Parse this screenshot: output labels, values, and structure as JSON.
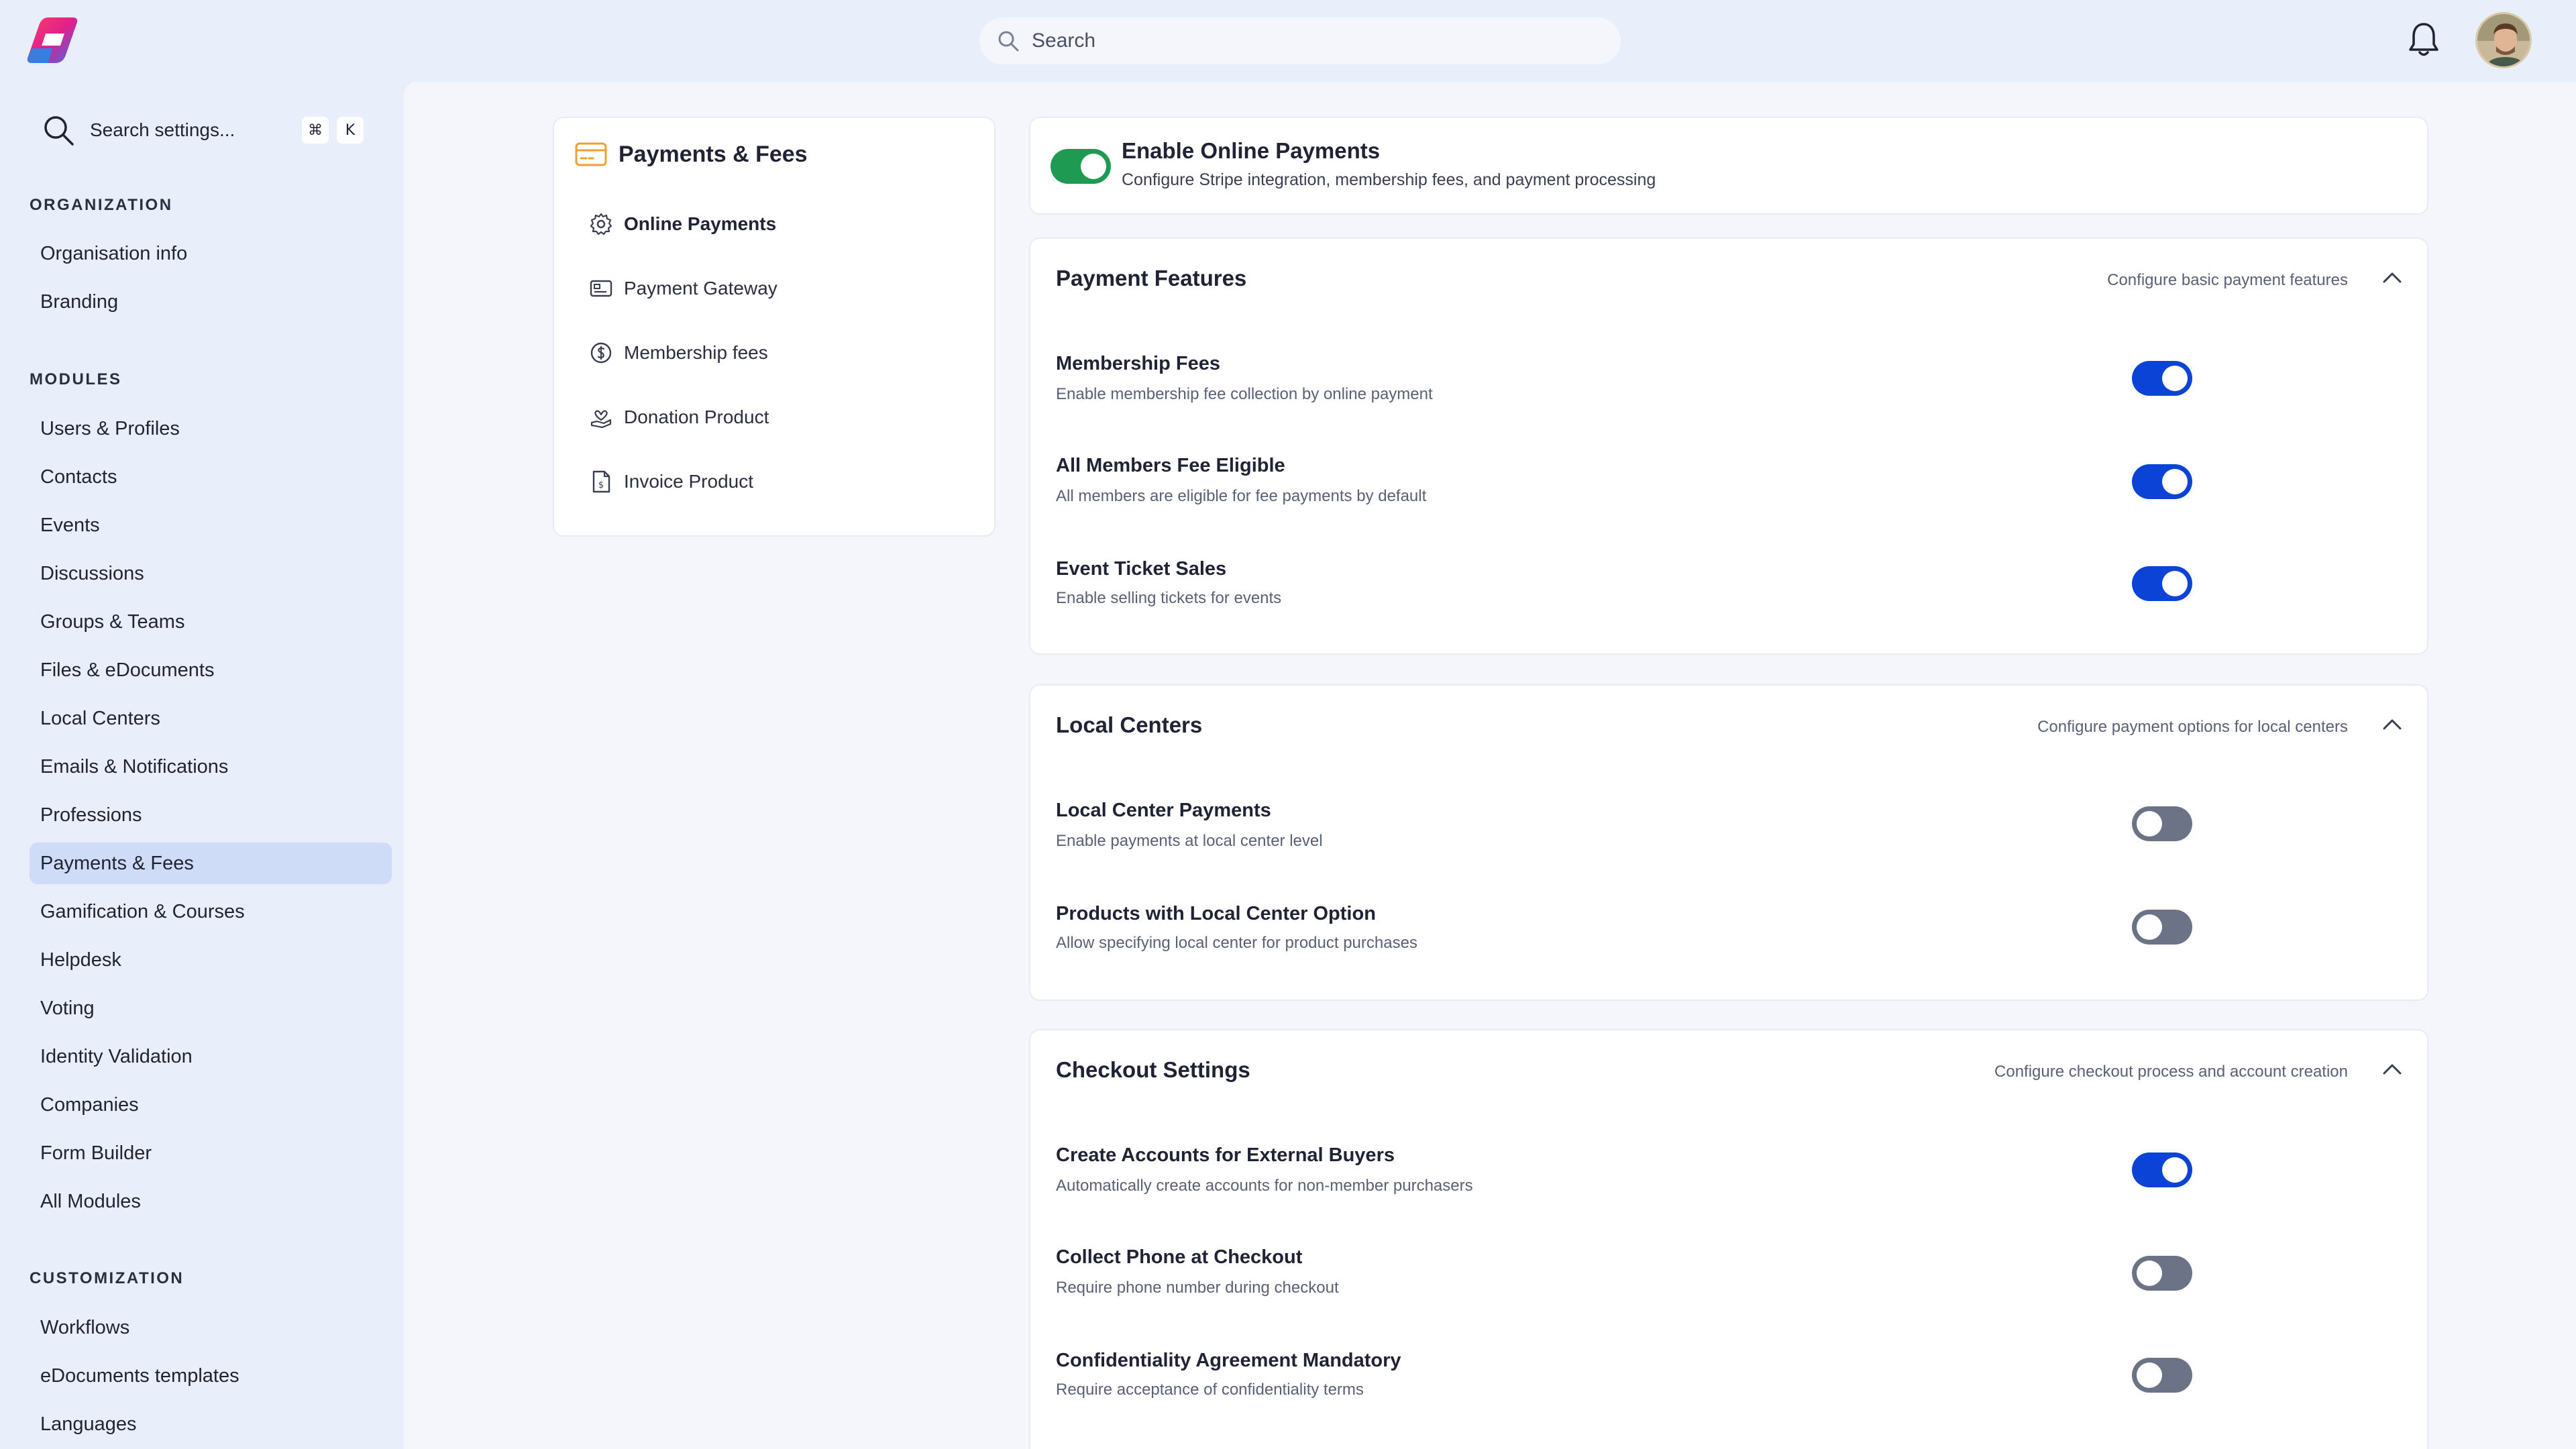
{
  "topbar": {
    "search_placeholder": "Search"
  },
  "sidebar": {
    "search_label": "Search settings...",
    "shortcut_keys": [
      "⌘",
      "K"
    ],
    "sections": [
      {
        "title": "ORGANIZATION",
        "items": [
          "Organisation info",
          "Branding"
        ]
      },
      {
        "title": "MODULES",
        "items": [
          "Users & Profiles",
          "Contacts",
          "Events",
          "Discussions",
          "Groups & Teams",
          "Files & eDocuments",
          "Local Centers",
          "Emails & Notifications",
          "Professions",
          "Payments & Fees",
          "Gamification & Courses",
          "Helpdesk",
          "Voting",
          "Identity Validation",
          "Companies",
          "Form Builder",
          "All Modules"
        ]
      },
      {
        "title": "CUSTOMIZATION",
        "items": [
          "Workflows",
          "eDocuments templates",
          "Languages"
        ]
      }
    ],
    "active_item": "Payments & Fees"
  },
  "subnav": {
    "title": "Payments & Fees",
    "items": [
      {
        "label": "Online Payments",
        "icon": "gear-icon",
        "active": true
      },
      {
        "label": "Payment Gateway",
        "icon": "gateway-icon",
        "active": false
      },
      {
        "label": "Membership fees",
        "icon": "dollar-circle-icon",
        "active": false
      },
      {
        "label": "Donation Product",
        "icon": "hand-heart-icon",
        "active": false
      },
      {
        "label": "Invoice Product",
        "icon": "invoice-icon",
        "active": false
      }
    ]
  },
  "enable": {
    "title": "Enable Online Payments",
    "description": "Configure Stripe integration, membership fees, and payment processing",
    "enabled": true
  },
  "sections": [
    {
      "title": "Payment Features",
      "description": "Configure basic payment features",
      "rows": [
        {
          "title": "Membership Fees",
          "description": "Enable membership fee collection by online payment",
          "on": true
        },
        {
          "title": "All Members Fee Eligible",
          "description": "All members are eligible for fee payments by default",
          "on": true
        },
        {
          "title": "Event Ticket Sales",
          "description": "Enable selling tickets for events",
          "on": true
        }
      ]
    },
    {
      "title": "Local Centers",
      "description": "Configure payment options for local centers",
      "rows": [
        {
          "title": "Local Center Payments",
          "description": "Enable payments at local center level",
          "on": false
        },
        {
          "title": "Products with Local Center Option",
          "description": "Allow specifying local center for product purchases",
          "on": false
        }
      ]
    },
    {
      "title": "Checkout Settings",
      "description": "Configure checkout process and account creation",
      "rows": [
        {
          "title": "Create Accounts for External Buyers",
          "description": "Automatically create accounts for non-member purchasers",
          "on": true
        },
        {
          "title": "Collect Phone at Checkout",
          "description": "Require phone number during checkout",
          "on": false
        },
        {
          "title": "Confidentiality Agreement Mandatory",
          "description": "Require acceptance of confidentiality terms",
          "on": false
        }
      ]
    }
  ],
  "colors": {
    "toggle_on": "#0a43d6",
    "toggle_off": "#6c7387",
    "master_toggle": "#1f9a52",
    "active_nav_bg": "#cfdcf7",
    "accent_orange": "#f0a030"
  }
}
